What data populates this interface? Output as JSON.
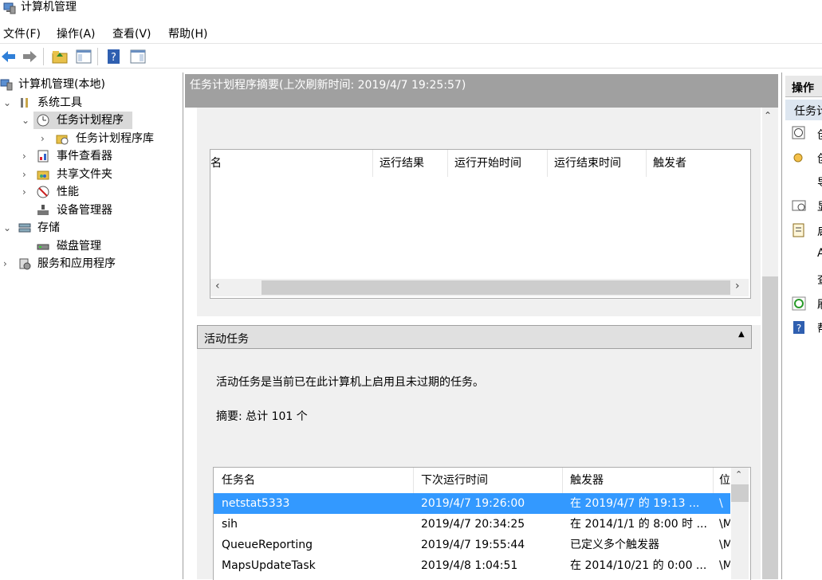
{
  "window": {
    "title": "计算机管理"
  },
  "menu": [
    "文件(F)",
    "操作(A)",
    "查看(V)",
    "帮助(H)"
  ],
  "toolbar": {
    "icons": [
      "back-arrow-icon",
      "forward-arrow-icon",
      "up-folder-icon",
      "show-hide-tree-icon",
      "help-icon",
      "show-hide-action-pane-icon"
    ]
  },
  "tree": {
    "root": "计算机管理(本地)",
    "system_tools": "系统工具",
    "task_scheduler": "任务计划程序",
    "task_scheduler_library": "任务计划程序库",
    "event_viewer": "事件查看器",
    "shared_folders": "共享文件夹",
    "performance": "性能",
    "device_manager": "设备管理器",
    "storage": "存储",
    "disk_management": "磁盘管理",
    "services_apps": "服务和应用程序"
  },
  "summary": {
    "header": "任务计划程序摘要(上次刷新时间: 2019/4/7 19:25:57)",
    "status_columns": [
      "名",
      "运行结果",
      "运行开始时间",
      "运行结束时间",
      "触发者"
    ]
  },
  "active_tasks": {
    "title": "活动任务",
    "description": "活动任务是当前已在此计算机上启用且未过期的任务。",
    "summary": "摘要: 总计 101 个",
    "columns": [
      "任务名",
      "下次运行时间",
      "触发器",
      "位"
    ],
    "rows": [
      {
        "name": "netstat5333",
        "next_run": "2019/4/7 19:26:00",
        "trigger": "在 2019/4/7 的 19:13 ...",
        "loc": "\\"
      },
      {
        "name": "sih",
        "next_run": "2019/4/7 20:34:25",
        "trigger": "在 2014/1/1 的 8:00 时 ...",
        "loc": "\\M"
      },
      {
        "name": "QueueReporting",
        "next_run": "2019/4/7 19:55:44",
        "trigger": "已定义多个触发器",
        "loc": "\\M"
      },
      {
        "name": "MapsUpdateTask",
        "next_run": "2019/4/8 1:04:51",
        "trigger": "在 2014/10/21 的 0:00 ...",
        "loc": "\\M"
      }
    ]
  },
  "actions": {
    "title": "操作",
    "section": "任务计",
    "items": [
      "创",
      "创",
      "导",
      "显",
      "启",
      "A",
      "查",
      "刷",
      "帮"
    ]
  },
  "colors": {
    "selection": "#3399ff",
    "header_gray": "#a0a0a0"
  }
}
